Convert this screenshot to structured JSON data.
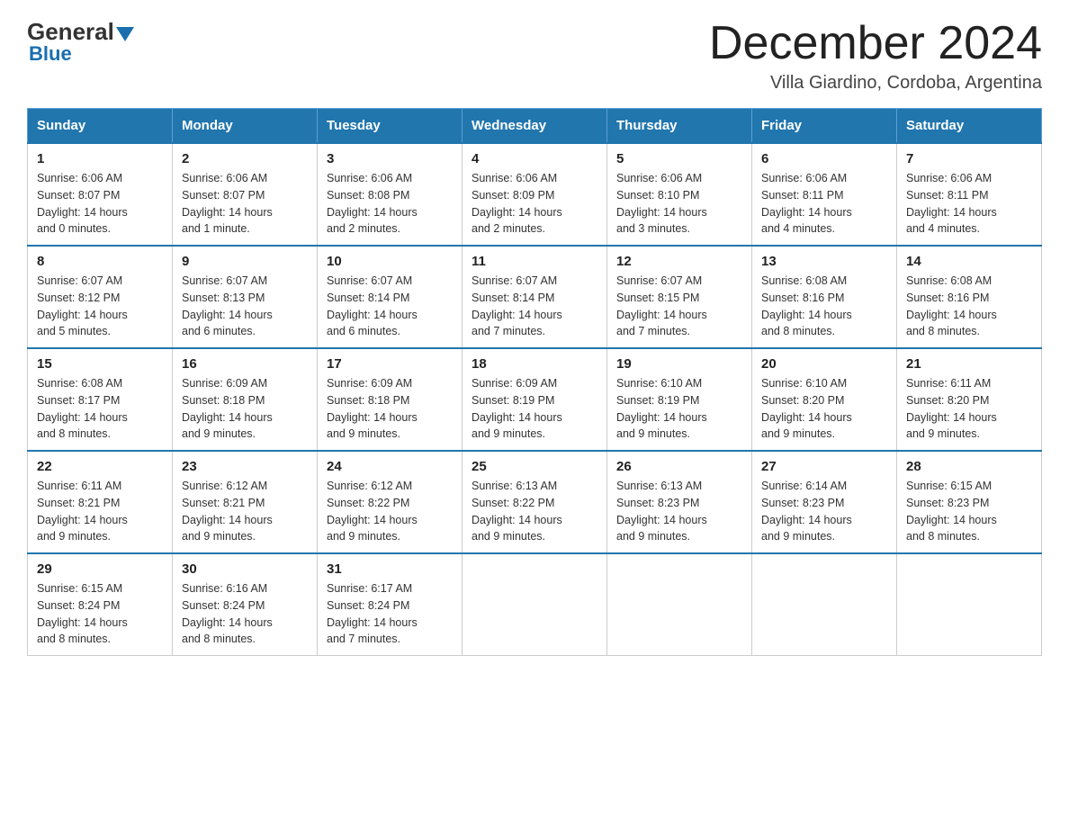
{
  "header": {
    "logo_general": "General",
    "logo_blue": "Blue",
    "main_title": "December 2024",
    "subtitle": "Villa Giardino, Cordoba, Argentina"
  },
  "days_of_week": [
    "Sunday",
    "Monday",
    "Tuesday",
    "Wednesday",
    "Thursday",
    "Friday",
    "Saturday"
  ],
  "weeks": [
    [
      {
        "day": "1",
        "sunrise": "6:06 AM",
        "sunset": "8:07 PM",
        "daylight": "14 hours and 0 minutes."
      },
      {
        "day": "2",
        "sunrise": "6:06 AM",
        "sunset": "8:07 PM",
        "daylight": "14 hours and 1 minute."
      },
      {
        "day": "3",
        "sunrise": "6:06 AM",
        "sunset": "8:08 PM",
        "daylight": "14 hours and 2 minutes."
      },
      {
        "day": "4",
        "sunrise": "6:06 AM",
        "sunset": "8:09 PM",
        "daylight": "14 hours and 2 minutes."
      },
      {
        "day": "5",
        "sunrise": "6:06 AM",
        "sunset": "8:10 PM",
        "daylight": "14 hours and 3 minutes."
      },
      {
        "day": "6",
        "sunrise": "6:06 AM",
        "sunset": "8:11 PM",
        "daylight": "14 hours and 4 minutes."
      },
      {
        "day": "7",
        "sunrise": "6:06 AM",
        "sunset": "8:11 PM",
        "daylight": "14 hours and 4 minutes."
      }
    ],
    [
      {
        "day": "8",
        "sunrise": "6:07 AM",
        "sunset": "8:12 PM",
        "daylight": "14 hours and 5 minutes."
      },
      {
        "day": "9",
        "sunrise": "6:07 AM",
        "sunset": "8:13 PM",
        "daylight": "14 hours and 6 minutes."
      },
      {
        "day": "10",
        "sunrise": "6:07 AM",
        "sunset": "8:14 PM",
        "daylight": "14 hours and 6 minutes."
      },
      {
        "day": "11",
        "sunrise": "6:07 AM",
        "sunset": "8:14 PM",
        "daylight": "14 hours and 7 minutes."
      },
      {
        "day": "12",
        "sunrise": "6:07 AM",
        "sunset": "8:15 PM",
        "daylight": "14 hours and 7 minutes."
      },
      {
        "day": "13",
        "sunrise": "6:08 AM",
        "sunset": "8:16 PM",
        "daylight": "14 hours and 8 minutes."
      },
      {
        "day": "14",
        "sunrise": "6:08 AM",
        "sunset": "8:16 PM",
        "daylight": "14 hours and 8 minutes."
      }
    ],
    [
      {
        "day": "15",
        "sunrise": "6:08 AM",
        "sunset": "8:17 PM",
        "daylight": "14 hours and 8 minutes."
      },
      {
        "day": "16",
        "sunrise": "6:09 AM",
        "sunset": "8:18 PM",
        "daylight": "14 hours and 9 minutes."
      },
      {
        "day": "17",
        "sunrise": "6:09 AM",
        "sunset": "8:18 PM",
        "daylight": "14 hours and 9 minutes."
      },
      {
        "day": "18",
        "sunrise": "6:09 AM",
        "sunset": "8:19 PM",
        "daylight": "14 hours and 9 minutes."
      },
      {
        "day": "19",
        "sunrise": "6:10 AM",
        "sunset": "8:19 PM",
        "daylight": "14 hours and 9 minutes."
      },
      {
        "day": "20",
        "sunrise": "6:10 AM",
        "sunset": "8:20 PM",
        "daylight": "14 hours and 9 minutes."
      },
      {
        "day": "21",
        "sunrise": "6:11 AM",
        "sunset": "8:20 PM",
        "daylight": "14 hours and 9 minutes."
      }
    ],
    [
      {
        "day": "22",
        "sunrise": "6:11 AM",
        "sunset": "8:21 PM",
        "daylight": "14 hours and 9 minutes."
      },
      {
        "day": "23",
        "sunrise": "6:12 AM",
        "sunset": "8:21 PM",
        "daylight": "14 hours and 9 minutes."
      },
      {
        "day": "24",
        "sunrise": "6:12 AM",
        "sunset": "8:22 PM",
        "daylight": "14 hours and 9 minutes."
      },
      {
        "day": "25",
        "sunrise": "6:13 AM",
        "sunset": "8:22 PM",
        "daylight": "14 hours and 9 minutes."
      },
      {
        "day": "26",
        "sunrise": "6:13 AM",
        "sunset": "8:23 PM",
        "daylight": "14 hours and 9 minutes."
      },
      {
        "day": "27",
        "sunrise": "6:14 AM",
        "sunset": "8:23 PM",
        "daylight": "14 hours and 9 minutes."
      },
      {
        "day": "28",
        "sunrise": "6:15 AM",
        "sunset": "8:23 PM",
        "daylight": "14 hours and 8 minutes."
      }
    ],
    [
      {
        "day": "29",
        "sunrise": "6:15 AM",
        "sunset": "8:24 PM",
        "daylight": "14 hours and 8 minutes."
      },
      {
        "day": "30",
        "sunrise": "6:16 AM",
        "sunset": "8:24 PM",
        "daylight": "14 hours and 8 minutes."
      },
      {
        "day": "31",
        "sunrise": "6:17 AM",
        "sunset": "8:24 PM",
        "daylight": "14 hours and 7 minutes."
      },
      null,
      null,
      null,
      null
    ]
  ]
}
